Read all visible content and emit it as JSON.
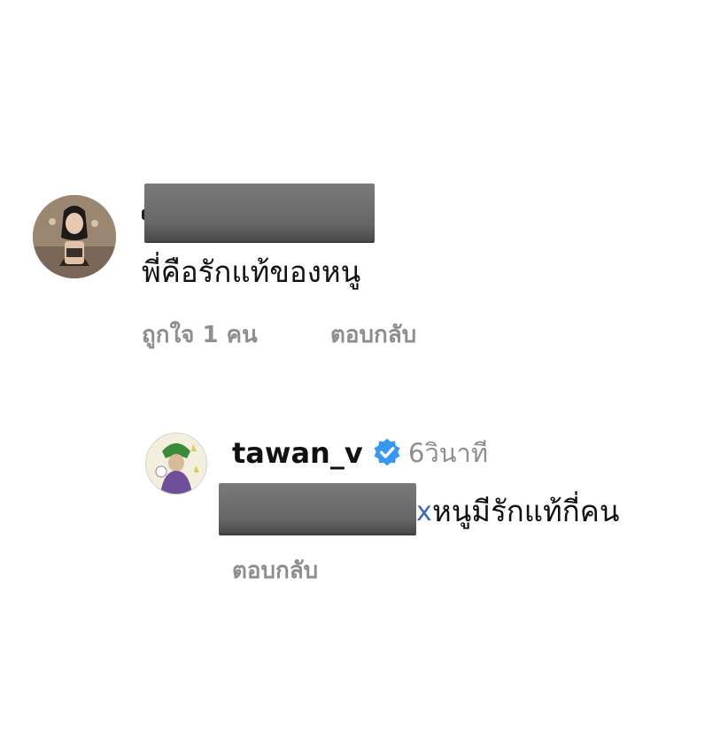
{
  "comment": {
    "text": "พี่คือรักแท้ของหนู",
    "likes_label": "ถูกใจ 1 คน",
    "reply_label": "ตอบกลับ"
  },
  "reply": {
    "username": "tawan_v",
    "verified": true,
    "time": "6วินาที",
    "partial_mention_char": "x",
    "text": "หนูมีรักแท้กี่คน",
    "reply_label": "ตอบกลับ"
  },
  "colors": {
    "text": "#111111",
    "muted": "#8e8e8e",
    "verified_badge": "#3897f0",
    "redaction": "#6b6b6b"
  },
  "icons": {
    "verified": "verified-badge-icon"
  }
}
